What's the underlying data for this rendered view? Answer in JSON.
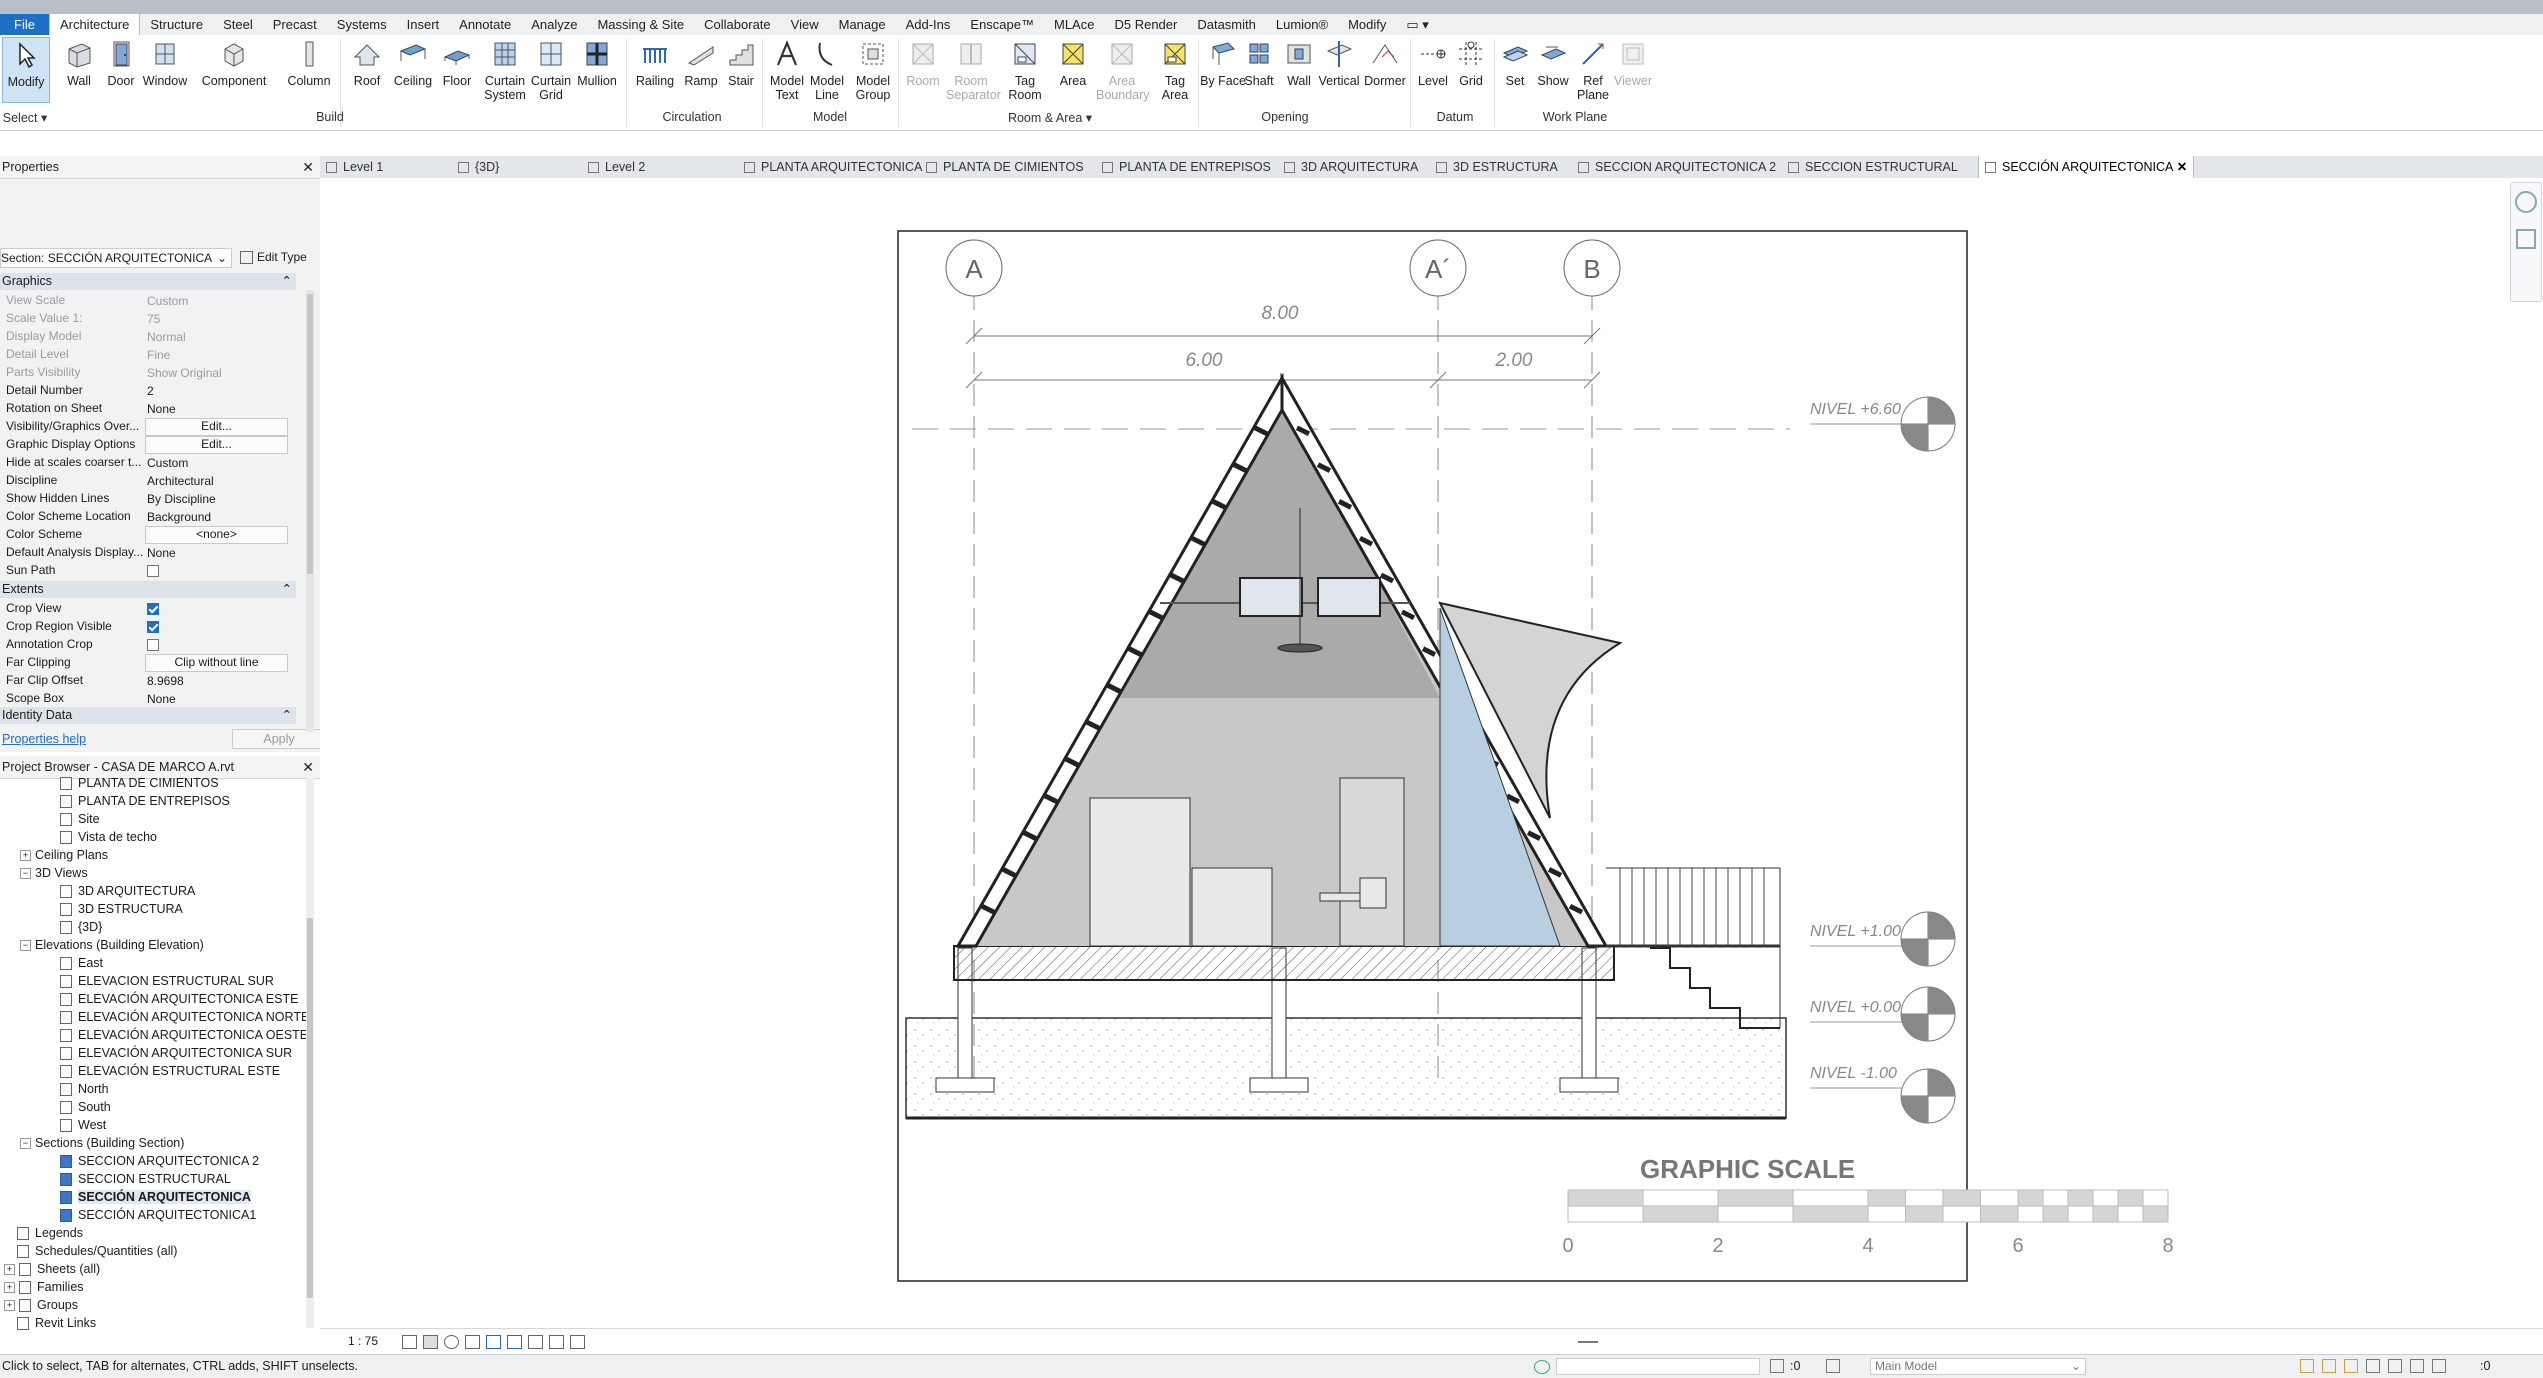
{
  "menu": {
    "tabs": [
      "File",
      "Architecture",
      "Structure",
      "Steel",
      "Precast",
      "Systems",
      "Insert",
      "Annotate",
      "Analyze",
      "Massing & Site",
      "Collaborate",
      "View",
      "Manage",
      "Add-Ins",
      "Enscape™",
      "MLAce",
      "D5 Render",
      "Datasmith",
      "Lumion®",
      "Modify"
    ],
    "active": "Architecture"
  },
  "ribbon": {
    "buttons": [
      {
        "label": "Modify",
        "icon": "modify-cursor-icon"
      },
      {
        "label": "Wall",
        "icon": "wall-icon"
      },
      {
        "label": "Door",
        "icon": "door-icon"
      },
      {
        "label": "Window",
        "icon": "window-icon"
      },
      {
        "label": "Component",
        "icon": "component-icon"
      },
      {
        "label": "Column",
        "icon": "column-icon"
      },
      {
        "label": "Roof",
        "icon": "roof-icon"
      },
      {
        "label": "Ceiling",
        "icon": "ceiling-icon"
      },
      {
        "label": "Floor",
        "icon": "floor-icon"
      },
      {
        "label": "Curtain System",
        "icon": "curtain-system-icon"
      },
      {
        "label": "Curtain Grid",
        "icon": "curtain-grid-icon"
      },
      {
        "label": "Mullion",
        "icon": "mullion-icon"
      },
      {
        "label": "Railing",
        "icon": "railing-icon"
      },
      {
        "label": "Ramp",
        "icon": "ramp-icon"
      },
      {
        "label": "Stair",
        "icon": "stair-icon"
      },
      {
        "label": "Model Text",
        "icon": "model-text-icon"
      },
      {
        "label": "Model Line",
        "icon": "model-line-icon"
      },
      {
        "label": "Model Group",
        "icon": "model-group-icon"
      },
      {
        "label": "Room",
        "icon": "room-icon"
      },
      {
        "label": "Room Separator",
        "icon": "room-separator-icon"
      },
      {
        "label": "Tag Room",
        "icon": "tag-room-icon"
      },
      {
        "label": "Area",
        "icon": "area-icon"
      },
      {
        "label": "Area Boundary",
        "icon": "area-boundary-icon"
      },
      {
        "label": "Tag Area",
        "icon": "tag-area-icon"
      },
      {
        "label": "By Face",
        "icon": "by-face-icon"
      },
      {
        "label": "Shaft",
        "icon": "shaft-icon"
      },
      {
        "label": "Wall",
        "icon": "wall-opening-icon"
      },
      {
        "label": "Vertical",
        "icon": "vertical-opening-icon"
      },
      {
        "label": "Dormer",
        "icon": "dormer-icon"
      },
      {
        "label": "Level",
        "icon": "level-icon"
      },
      {
        "label": "Grid",
        "icon": "grid-icon"
      },
      {
        "label": "Set",
        "icon": "set-workplane-icon"
      },
      {
        "label": "Show",
        "icon": "show-workplane-icon"
      },
      {
        "label": "Ref Plane",
        "icon": "ref-plane-icon"
      },
      {
        "label": "Viewer",
        "icon": "viewer-icon"
      }
    ],
    "panels": [
      "Select",
      "Build",
      "Circulation",
      "Model",
      "Room & Area",
      "Opening",
      "Datum",
      "Work Plane"
    ]
  },
  "properties": {
    "title": "Properties",
    "type_selector": "Section: SECCIÓN ARQUITECTONICA",
    "edit_type": "Edit Type",
    "groups": {
      "graphics": "Graphics",
      "extents": "Extents",
      "identity": "Identity Data"
    },
    "rows": [
      [
        "View Scale",
        "Custom"
      ],
      [
        "Scale Value    1:",
        "75"
      ],
      [
        "Display Model",
        "Normal"
      ],
      [
        "Detail Level",
        "Fine"
      ],
      [
        "Parts Visibility",
        "Show Original"
      ],
      [
        "Detail Number",
        "2"
      ],
      [
        "Rotation on Sheet",
        "None"
      ],
      [
        "Visibility/Graphics Over...",
        "Edit..."
      ],
      [
        "Graphic Display Options",
        "Edit..."
      ],
      [
        "Hide at scales coarser t...",
        "Custom"
      ],
      [
        "Discipline",
        "Architectural"
      ],
      [
        "Show Hidden Lines",
        "By Discipline"
      ],
      [
        "Color Scheme Location",
        "Background"
      ],
      [
        "Color Scheme",
        "<none>"
      ],
      [
        "Default Analysis Display...",
        "None"
      ],
      [
        "Sun Path",
        ""
      ]
    ],
    "extents_rows": [
      [
        "Crop View",
        ""
      ],
      [
        "Crop Region Visible",
        ""
      ],
      [
        "Annotation Crop",
        ""
      ],
      [
        "Far Clipping",
        "Clip without line"
      ],
      [
        "Far Clip Offset",
        "8.9698"
      ],
      [
        "Scope Box",
        "None"
      ]
    ],
    "help": "Properties help",
    "apply": "Apply"
  },
  "project_browser": {
    "title": "Project Browser - CASA DE MARCO A.rvt",
    "items": [
      "PLANTA DE CIMIENTOS",
      "PLANTA DE ENTREPISOS",
      "Site",
      "Vista de techo",
      "Ceiling Plans",
      "3D Views",
      "3D ARQUITECTURA",
      "3D ESTRUCTURA",
      "{3D}",
      "Elevations (Building Elevation)",
      "East",
      "ELEVACION ESTRUCTURAL SUR",
      "ELEVACIÓN ARQUITECTONICA ESTE",
      "ELEVACIÓN ARQUITECTONICA NORTE",
      "ELEVACIÓN ARQUITECTONICA OESTE",
      "ELEVACIÓN ARQUITECTONICA SUR",
      "ELEVACIÓN ESTRUCTURAL ESTE",
      "North",
      "South",
      "West",
      "Sections (Building Section)",
      "SECCION ARQUITECTONICA 2",
      "SECCION ESTRUCTURAL",
      "SECCIÓN ARQUITECTONICA",
      "SECCIÓN ARQUITECTONICA1",
      "Legends",
      "Schedules/Quantities (all)",
      "Sheets (all)",
      "Families",
      "Groups",
      "Revit Links"
    ]
  },
  "view_tabs": [
    "Level 1",
    "{3D}",
    "Level 2",
    "PLANTA ARQUITECTONICA",
    "PLANTA DE CIMIENTOS",
    "PLANTA DE ENTREPISOS",
    "3D ARQUITECTURA",
    "3D ESTRUCTURA",
    "SECCION ARQUITECTONICA 2",
    "SECCION ESTRUCTURAL",
    "SECCIÓN ARQUITECTONICA"
  ],
  "drawing": {
    "grids": [
      "A",
      "A´",
      "B"
    ],
    "dims": [
      "8.00",
      "6.00",
      "2.00"
    ],
    "levels": [
      "NIVEL +6.60",
      "NIVEL +1.00",
      "NIVEL +0.00",
      "NIVEL -1.00"
    ],
    "scale_title": "GRAPHIC SCALE",
    "scale_ticks": [
      "0",
      "2",
      "4",
      "6",
      "8"
    ]
  },
  "view_control": {
    "scale": "1 : 75"
  },
  "status": {
    "hint": "Click to select, TAB for alternates, CTRL adds, SHIFT unselects.",
    "zero": ":0",
    "model": "Main Model",
    "filter_count": ":0"
  }
}
